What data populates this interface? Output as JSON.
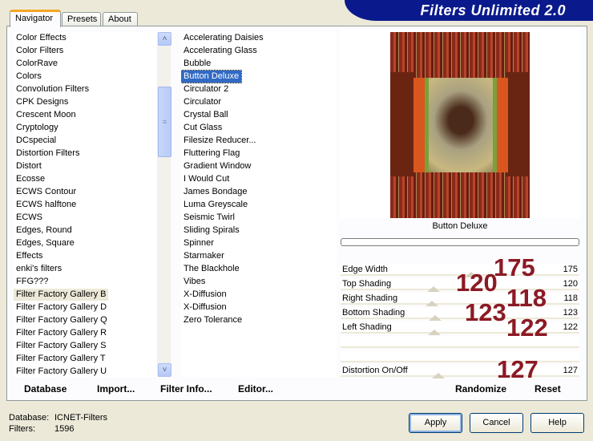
{
  "app": {
    "title": "Filters Unlimited 2.0"
  },
  "tabs": [
    {
      "label": "Navigator"
    },
    {
      "label": "Presets"
    },
    {
      "label": "About"
    }
  ],
  "categories": {
    "items": [
      "Color Effects",
      "Color Filters",
      "ColorRave",
      "Colors",
      "Convolution Filters",
      "CPK Designs",
      "Crescent Moon",
      "Cryptology",
      "DCspecial",
      "Distortion Filters",
      "Distort",
      "Ecosse",
      "ECWS Contour",
      "ECWS halftone",
      "ECWS",
      "Edges, Round",
      "Edges, Square",
      "Effects",
      "enki's filters",
      "FFG???",
      "Filter Factory Gallery B",
      "Filter Factory Gallery D",
      "Filter Factory Gallery Q",
      "Filter Factory Gallery R",
      "Filter Factory Gallery S",
      "Filter Factory Gallery T",
      "Filter Factory Gallery U"
    ],
    "selected": "Filter Factory Gallery B"
  },
  "filters": {
    "items": [
      "Accelerating Daisies",
      "Accelerating Glass",
      "Bubble",
      "Button Deluxe",
      "Circulator 2",
      "Circulator",
      "Crystal Ball",
      "Cut Glass",
      "Filesize Reducer...",
      "Fluttering Flag",
      "Gradient Window",
      "I Would Cut",
      "James Bondage",
      "Luma Greyscale",
      "Seismic Twirl",
      "Sliding Spirals",
      "Spinner",
      "Starmaker",
      "The Blackhole",
      "Vibes",
      "X-Diffusion",
      "X-Diffusion",
      "Zero Tolerance"
    ],
    "selected": "Button Deluxe"
  },
  "preview": {
    "filter_name": "Button Deluxe",
    "progress": 0
  },
  "sliders": [
    {
      "label": "Edge Width",
      "value": "175",
      "level": 175,
      "max": 255
    },
    {
      "label": "Top Shading",
      "value": "120",
      "level": 120,
      "max": 255
    },
    {
      "label": "Right Shading",
      "value": "118",
      "level": 118,
      "max": 255
    },
    {
      "label": "Bottom Shading",
      "value": "123",
      "level": 123,
      "max": 255
    },
    {
      "label": "Left Shading",
      "value": "122",
      "level": 122,
      "max": 255
    },
    {
      "label": "",
      "value": ""
    },
    {
      "label": "",
      "value": ""
    },
    {
      "label": "Distortion On/Off",
      "value": "127",
      "level": 127,
      "max": 255
    }
  ],
  "annotations": [
    "175",
    "120",
    "118",
    "123",
    "122",
    "127"
  ],
  "bottom_bar": {
    "database": "Database",
    "import": "Import...",
    "filter_info": "Filter Info...",
    "editor": "Editor...",
    "randomize": "Randomize",
    "reset": "Reset"
  },
  "status": {
    "database_label": "Database:",
    "database_value": "ICNET-Filters",
    "filters_label": "Filters:",
    "filters_value": "1596"
  },
  "buttons": {
    "apply": "Apply",
    "cancel": "Cancel",
    "help": "Help"
  },
  "colors": {
    "banner": "#0a1a8c",
    "selection": "#316ac5",
    "annotation": "#8b1a24",
    "tab_accent": "#f5a623"
  }
}
